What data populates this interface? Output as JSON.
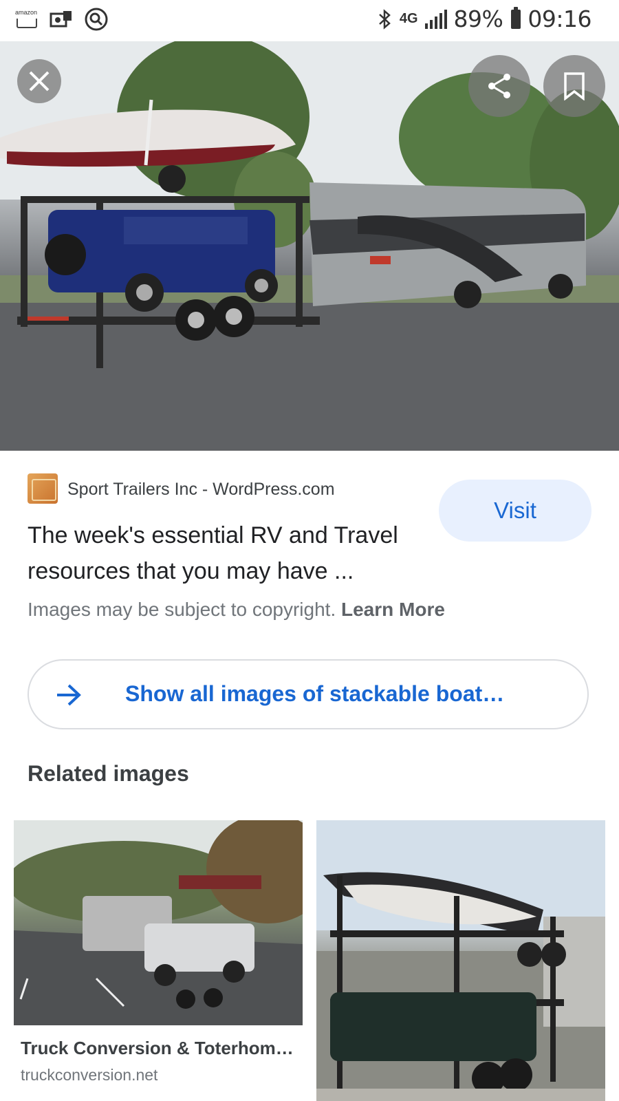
{
  "status_bar": {
    "amazon_label": "amazon",
    "network": "4G",
    "battery": "89%",
    "time": "09:16"
  },
  "viewer": {
    "source": "Sport Trailers Inc - WordPress.com",
    "visit_label": "Visit",
    "title": "The week's essential RV and Travel resources that you may have ...",
    "copyright_text": "Images may be subject to copyright.",
    "learn_more": "Learn More",
    "show_all_label": "Show all images of stackable boat…"
  },
  "related": {
    "heading": "Related images",
    "items": [
      {
        "title": "Truck Conversion & Toterhom…",
        "domain": "truckconversion.net"
      },
      {
        "title": "",
        "domain": ""
      }
    ]
  },
  "colors": {
    "accent": "#1967d2",
    "visit_bg": "#e8f0fe"
  }
}
